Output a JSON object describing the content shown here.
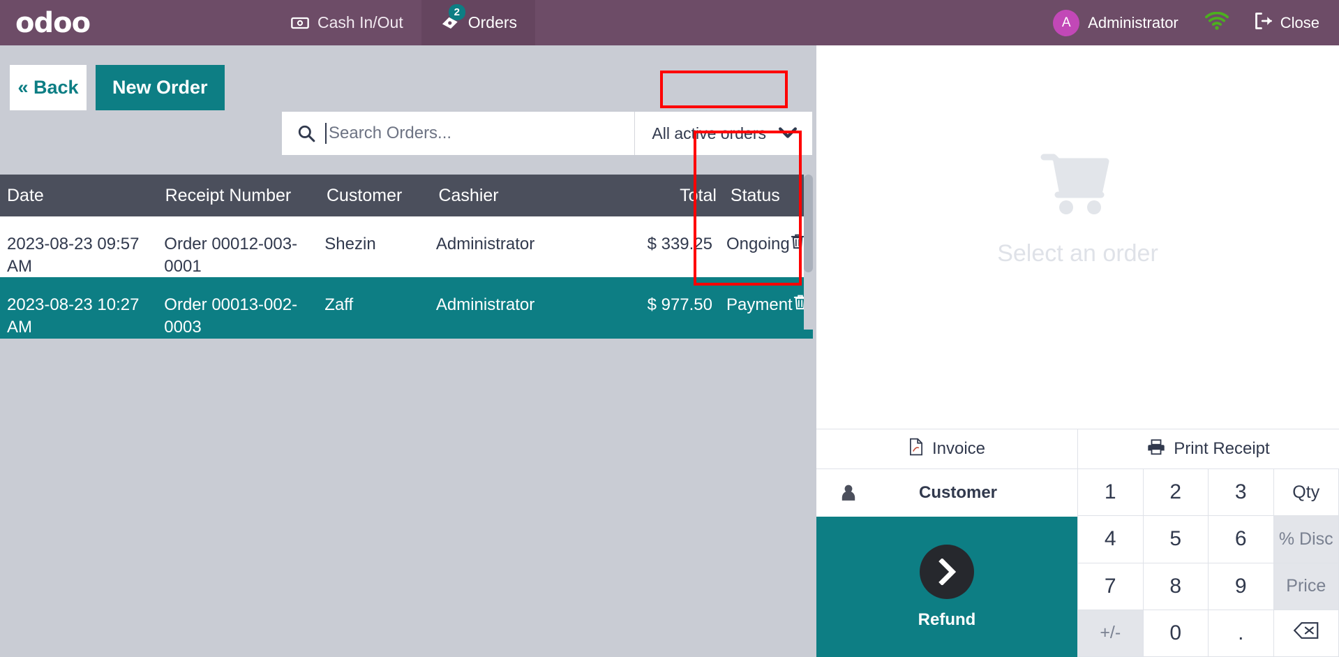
{
  "header": {
    "logo": "odoo",
    "tabs": [
      {
        "label": "Cash In/Out",
        "icon": "cash-icon",
        "active": false,
        "badge": ""
      },
      {
        "label": "Orders",
        "icon": "receipt-icon",
        "active": true,
        "badge": "2"
      }
    ],
    "user": {
      "initial": "A",
      "name": "Administrator"
    },
    "wifi_icon": "wifi-icon",
    "close_label": "Close",
    "colors": {
      "bar": "#6d4c67",
      "tab_active": "#65455f",
      "avatar": "#c248b7",
      "badge": "#0d7e84",
      "wifi": "#4caf1f"
    }
  },
  "toolbar": {
    "back_label": "« Back",
    "new_order_label": "New Order"
  },
  "search": {
    "placeholder": "Search Orders...",
    "value": "",
    "icon": "search-icon"
  },
  "filter": {
    "selected": "All active orders",
    "caret_icon": "chevron-down-icon"
  },
  "table": {
    "columns": [
      "Date",
      "Receipt Number",
      "Customer",
      "Cashier",
      "Total",
      "Status"
    ],
    "rows": [
      {
        "date": "2023-08-23 09:57 AM",
        "receipt": "Order 00012-003-0001",
        "customer": "Shezin",
        "cashier": "Administrator",
        "total": "$ 339.25",
        "status": "Ongoing",
        "selected": false
      },
      {
        "date": "2023-08-23 10:27 AM",
        "receipt": "Order 00013-002-0003",
        "customer": "Zaff",
        "cashier": "Administrator",
        "total": "$ 977.50",
        "status": "Payment",
        "selected": true
      }
    ],
    "delete_icon": "trash-icon"
  },
  "order_panel": {
    "empty_icon": "shopping-cart-icon",
    "empty_label": "Select an order",
    "actions": [
      {
        "label": "Invoice",
        "icon": "pdf-file-icon"
      },
      {
        "label": "Print Receipt",
        "icon": "printer-icon"
      }
    ],
    "customer_label": "Customer",
    "customer_icon": "person-icon",
    "refund_label": "Refund",
    "refund_icon": "chevron-right-icon"
  },
  "numpad": {
    "keys": [
      {
        "label": "1",
        "type": "digit"
      },
      {
        "label": "2",
        "type": "digit"
      },
      {
        "label": "3",
        "type": "digit"
      },
      {
        "label": "Qty",
        "type": "mode"
      },
      {
        "label": "4",
        "type": "digit"
      },
      {
        "label": "5",
        "type": "digit"
      },
      {
        "label": "6",
        "type": "digit"
      },
      {
        "label": "% Disc",
        "type": "muted"
      },
      {
        "label": "7",
        "type": "digit"
      },
      {
        "label": "8",
        "type": "digit"
      },
      {
        "label": "9",
        "type": "digit"
      },
      {
        "label": "Price",
        "type": "muted"
      },
      {
        "label": "+/-",
        "type": "muted"
      },
      {
        "label": "0",
        "type": "digit"
      },
      {
        "label": ".",
        "type": "digit"
      },
      {
        "label": "backspace-icon",
        "type": "icon"
      }
    ]
  },
  "annotations": {
    "filter_box": true,
    "status_column_box": true,
    "color": "#ff0000"
  }
}
